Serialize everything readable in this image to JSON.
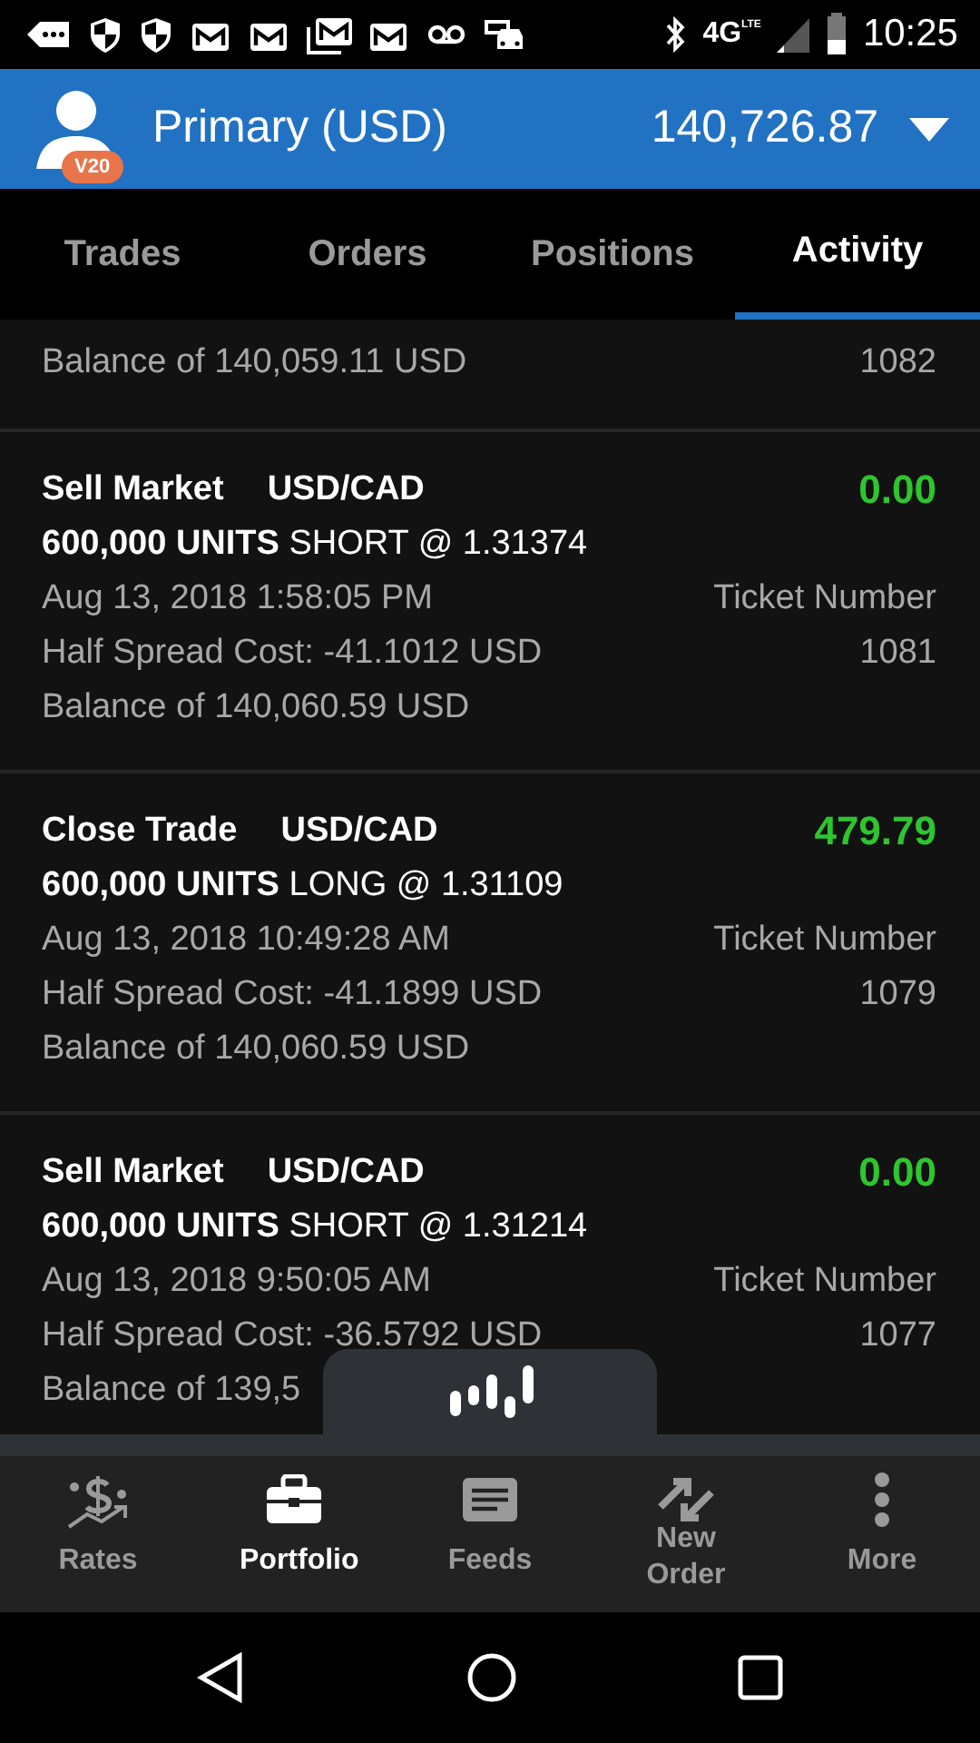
{
  "status_bar": {
    "network": "4G",
    "network_sub": "LTE",
    "time": "10:25"
  },
  "header": {
    "badge": "V20",
    "account": "Primary (USD)",
    "balance": "140,726.87"
  },
  "tabs": [
    {
      "label": "Trades",
      "selected": false
    },
    {
      "label": "Orders",
      "selected": false
    },
    {
      "label": "Positions",
      "selected": false
    },
    {
      "label": "Activity",
      "selected": true
    }
  ],
  "activity": [
    {
      "balance": "Balance of 140,059.11 USD",
      "ticket": "1082"
    },
    {
      "type": "Sell Market",
      "pair": "USD/CAD",
      "amount": "0.00",
      "units": "**600,000 UNITS** SHORT @ 1.31374",
      "date": "Aug 13, 2018 1:58:05 PM",
      "ticket_label": "Ticket Number",
      "spread": "Half Spread Cost: -41.1012 USD",
      "ticket": "1081",
      "balance": "Balance of 140,060.59 USD"
    },
    {
      "type": "Close Trade",
      "pair": "USD/CAD",
      "amount": "479.79",
      "units": "**600,000 UNITS** LONG @ 1.31109",
      "date": "Aug 13, 2018 10:49:28 AM",
      "ticket_label": "Ticket Number",
      "spread": "Half Spread Cost: -41.1899 USD",
      "ticket": "1079",
      "balance": "Balance of 140,060.59 USD"
    },
    {
      "type": "Sell Market",
      "pair": "USD/CAD",
      "amount": "0.00",
      "units": "**600,000 UNITS** SHORT @ 1.31214",
      "date": "Aug 13, 2018 9:50:05 AM",
      "ticket_label": "Ticket Number",
      "spread": "Half Spread Cost: -36.5792 USD",
      "ticket": "1077",
      "balance": "Balance of 139,5"
    }
  ],
  "bottom_nav": [
    {
      "label": "Rates",
      "selected": false
    },
    {
      "label": "Portfolio",
      "selected": true
    },
    {
      "label": "Feeds",
      "selected": false
    },
    {
      "label": "New Order",
      "selected": false
    },
    {
      "label": "More",
      "selected": false
    }
  ]
}
